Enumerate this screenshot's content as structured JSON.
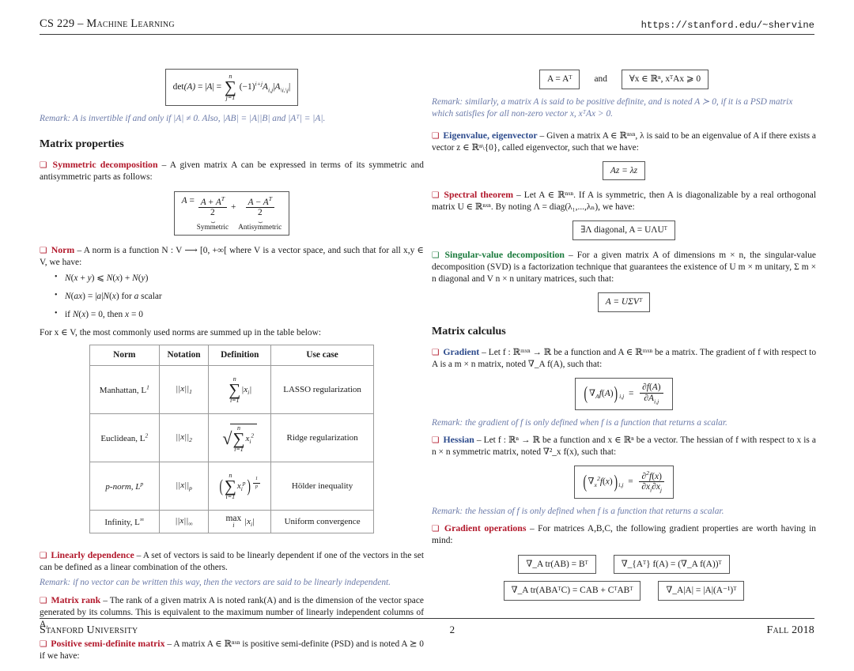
{
  "header": {
    "title": "CS 229 – Machine Learning",
    "url": "https://stanford.edu/~shervine"
  },
  "footer": {
    "left": "Stanford University",
    "page": "2",
    "right": "Fall 2018"
  },
  "colors": {
    "red": "#b2182b",
    "blue": "#2c4a8c",
    "green": "#1a7a3c",
    "remark": "#6b7aa8"
  },
  "left_column": {
    "determinant_formula": "det(A) = |A| = ∑(j=1..n) (-1)^{i+j} A_{i,j} |A_{\\i,\\j}|",
    "determinant_remark": "Remark: A is invertible if and only if |A| ≠ 0. Also, |AB| = |A||B| and |Aᵀ| = |A|.",
    "section_heading": "Matrix properties",
    "symmetric_decomposition": {
      "term": "Symmetric decomposition",
      "dash": "–",
      "body": "A given matrix A can be expressed in terms of its symmetric and antisymmetric parts as follows:",
      "formula": "A = (A + Aᵀ)/2 + (A − Aᵀ)/2",
      "brace_label_1": "Symmetric",
      "brace_label_2": "Antisymmetric"
    },
    "norm": {
      "term": "Norm",
      "dash": "–",
      "body_pre": "A norm is a function N : V ⟶ [0, +∞[ where V is a vector space, and such that for all x,y ∈ V, we have:",
      "items": [
        "N(x + y) ⩽ N(x) + N(y)",
        "N(ax) = |a|N(x) for a scalar",
        "if N(x) = 0, then x = 0"
      ],
      "body_post": "For x ∈ V, the most commonly used norms are summed up in the table below:"
    },
    "norms_table": {
      "headers": [
        "Norm",
        "Notation",
        "Definition",
        "Use case"
      ],
      "rows": [
        {
          "norm": "Manhattan, L",
          "norm_sup": "1",
          "notation": "||x||",
          "notation_sub": "1",
          "definition": "sum |x_i|, i=1..n",
          "use_case": "LASSO regularization"
        },
        {
          "norm": "Euclidean, L",
          "norm_sup": "2",
          "notation": "||x||",
          "notation_sub": "2",
          "definition": "sqrt( sum x_i^2, i=1..n )",
          "use_case": "Ridge regularization"
        },
        {
          "norm": "p-norm, L",
          "norm_sup": "p",
          "notation": "||x||",
          "notation_sub": "p",
          "definition": "( sum x_i^p, i=1..n )^{1/p}",
          "use_case": "Hölder inequality"
        },
        {
          "norm": "Infinity, L",
          "norm_sup": "∞",
          "notation": "||x||",
          "notation_sub": "∞",
          "definition": "max_i |x_i|",
          "use_case": "Uniform convergence"
        }
      ]
    },
    "linearly_dependence": {
      "term": "Linearly dependence",
      "dash": "–",
      "body": "A set of vectors is said to be linearly dependent if one of the vectors in the set can be defined as a linear combination of the others.",
      "remark": "Remark: if no vector can be written this way, then the vectors are said to be linearly independent."
    },
    "matrix_rank": {
      "term": "Matrix rank",
      "dash": "–",
      "body": "The rank of a given matrix A is noted rank(A) and is the dimension of the vector space generated by its columns. This is equivalent to the maximum number of linearly independent columns of A."
    },
    "psd": {
      "term": "Positive semi-definite matrix",
      "dash": "–",
      "body": "A matrix A ∈ ℝⁿˣⁿ is positive semi-definite (PSD) and is noted A ⪰ 0 if we have:"
    }
  },
  "right_column": {
    "psd_formula_1": "A = Aᵀ",
    "psd_and": "and",
    "psd_formula_2": "∀x ∈ ℝⁿ,  xᵀAx ⩾ 0",
    "psd_remark": "Remark: similarly, a matrix A is said to be positive definite, and is noted A ≻ 0, if it is a PSD matrix which satisfies for all non-zero vector x, xᵀAx > 0.",
    "eigen": {
      "term": "Eigenvalue, eigenvector",
      "dash": "–",
      "body": "Given a matrix A ∈ ℝⁿˣⁿ, λ is said to be an eigenvalue of A if there exists a vector z ∈ ℝⁿ\\{0}, called eigenvector, such that we have:",
      "formula": "Az = λz"
    },
    "spectral": {
      "term": "Spectral theorem",
      "dash": "–",
      "body": "Let A ∈ ℝⁿˣⁿ. If A is symmetric, then A is diagonalizable by a real orthogonal matrix U ∈ ℝⁿˣⁿ. By noting Λ = diag(λ₁,...,λₙ), we have:",
      "formula": "∃Λ diagonal,   A = UΛUᵀ"
    },
    "svd": {
      "term": "Singular-value decomposition",
      "dash": "–",
      "body": "For a given matrix A of dimensions m × n, the singular-value decomposition (SVD) is a factorization technique that guarantees the existence of U m × m unitary, Σ m × n diagonal and V n × n unitary matrices, such that:",
      "formula": "A = UΣVᵀ"
    },
    "section_heading": "Matrix calculus",
    "gradient": {
      "term": "Gradient",
      "dash": "–",
      "body": "Let f : ℝᵐˣⁿ → ℝ be a function and A ∈ ℝᵐˣⁿ be a matrix. The gradient of f with respect to A is a m × n matrix, noted ∇_A f(A), such that:",
      "formula": "(∇_A f(A))_{i,j} = ∂f(A)/∂A_{i,j}",
      "remark": "Remark: the gradient of f is only defined when f is a function that returns a scalar."
    },
    "hessian": {
      "term": "Hessian",
      "dash": "–",
      "body": "Let f : ℝⁿ → ℝ be a function and x ∈ ℝⁿ be a vector. The hessian of f with respect to x is a n × n symmetric matrix, noted ∇²_x f(x), such that:",
      "formula": "(∇²_x f(x))_{i,j} = ∂²f(x)/∂x_i∂x_j",
      "remark": "Remark: the hessian of f is only defined when f is a function that returns a scalar."
    },
    "gradient_operations": {
      "term": "Gradient operations",
      "dash": "–",
      "body": "For matrices A,B,C, the following gradient properties are worth having in mind:",
      "formulas": [
        "∇_A tr(AB) = Bᵀ",
        "∇_{Aᵀ} f(A) = (∇_A f(A))ᵀ",
        "∇_A tr(ABAᵀC) = CAB + CᵀABᵀ",
        "∇_A|A| = |A|(A⁻¹)ᵀ"
      ]
    }
  }
}
